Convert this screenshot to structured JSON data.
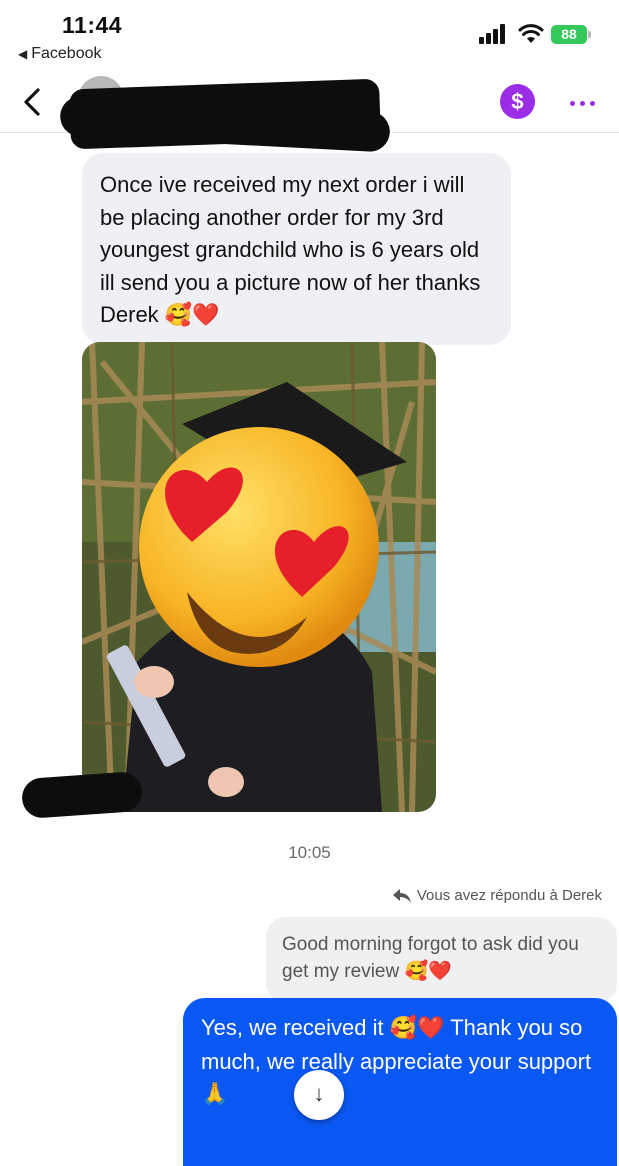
{
  "status_bar": {
    "time": "11:44",
    "back_app_label": "Facebook",
    "battery_level": "88",
    "signal_icon": "signal-bars-icon",
    "wifi_icon": "wifi-icon"
  },
  "header": {
    "back_icon": "chevron-left-icon",
    "pay_label": "$",
    "accent_color": "#9b2de6",
    "more_icon": "more-dots-icon"
  },
  "messages": {
    "incoming_text": "Once ive received my next order i will be placing another order for my 3rd youngest grandchild who is 6 years old ill send you a picture now of her thanks Derek",
    "incoming_emojis": "🥰❤️",
    "timestamp": "10:05",
    "replied_label": "Vous avez répondu à Derek",
    "quoted_text": "Good morning forgot to ask did you get my review",
    "quoted_emojis": "🥰❤️",
    "outgoing_text_before": "Yes, we received it ",
    "outgoing_emojis": "🥰❤️",
    "outgoing_text_after": " Thank you so much, we really appreciate your support",
    "outgoing_tail_emoji": "🙏",
    "outgoing_color": "#0a58f3"
  },
  "scroll_button_icon": "arrow-down-icon",
  "scroll_button_label": "↓"
}
